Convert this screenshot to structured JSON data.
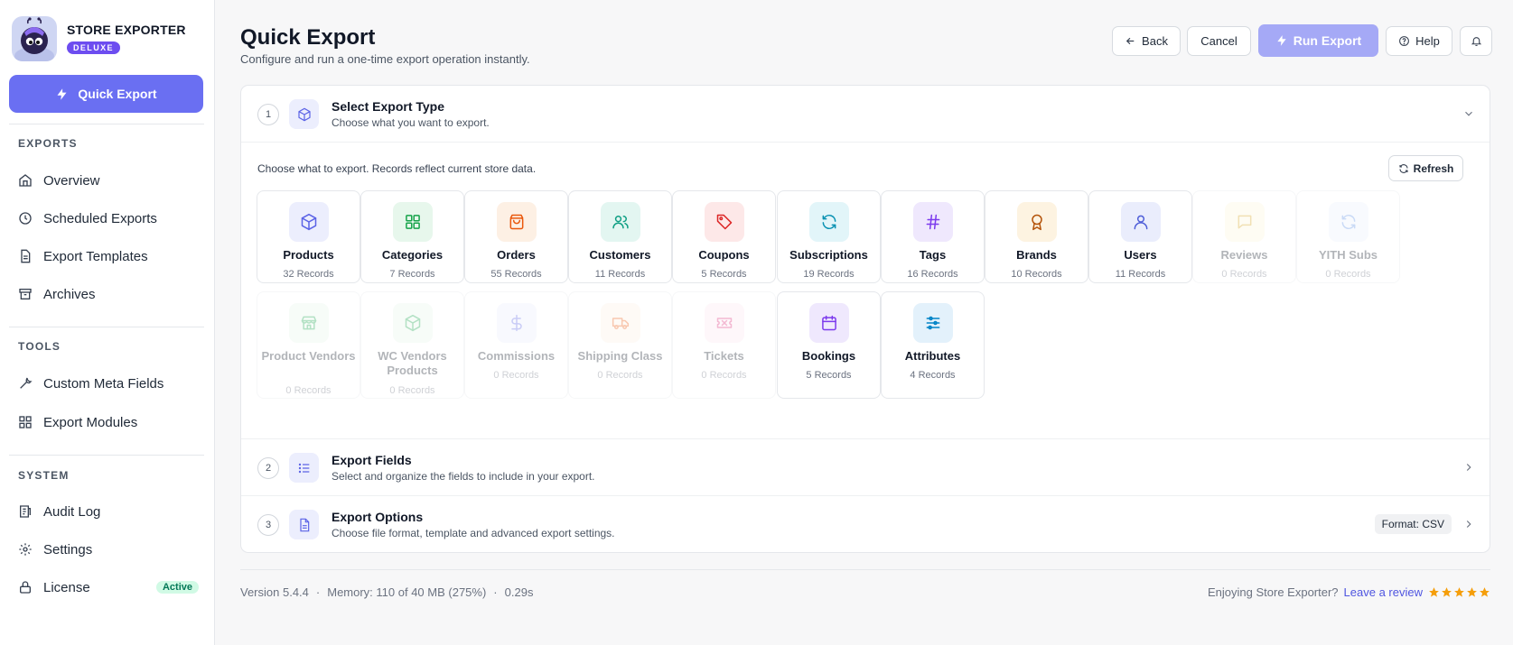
{
  "app": {
    "name": "STORE EXPORTER",
    "badge": "DELUXE"
  },
  "sidebar": {
    "quick_export_label": "Quick Export",
    "sections": [
      {
        "label": "EXPORTS",
        "items": [
          {
            "label": "Overview",
            "icon": "home-icon"
          },
          {
            "label": "Scheduled Exports",
            "icon": "clock-icon"
          },
          {
            "label": "Export Templates",
            "icon": "document-icon"
          },
          {
            "label": "Archives",
            "icon": "archive-icon"
          }
        ]
      },
      {
        "label": "TOOLS",
        "items": [
          {
            "label": "Custom Meta Fields",
            "icon": "wrench-icon"
          },
          {
            "label": "Export Modules",
            "icon": "grid-icon"
          }
        ]
      },
      {
        "label": "SYSTEM",
        "items": [
          {
            "label": "Audit Log",
            "icon": "log-icon"
          },
          {
            "label": "Settings",
            "icon": "gear-icon"
          },
          {
            "label": "License",
            "icon": "lock-icon",
            "badge": "Active"
          }
        ]
      }
    ]
  },
  "header": {
    "title": "Quick Export",
    "subtitle": "Configure and run a one-time export operation instantly.",
    "back_label": "Back",
    "cancel_label": "Cancel",
    "run_label": "Run Export",
    "help_label": "Help"
  },
  "steps": [
    {
      "num": "1",
      "title": "Select Export Type",
      "subtitle": "Choose what you want to export."
    },
    {
      "num": "2",
      "title": "Export Fields",
      "subtitle": "Select and organize the fields to include in your export."
    },
    {
      "num": "3",
      "title": "Export Options",
      "subtitle": "Choose file format, template and advanced export settings.",
      "badge": "Format: CSV"
    }
  ],
  "export_types": {
    "description": "Choose what to export. Records reflect current store data.",
    "refresh_label": "Refresh",
    "items": [
      {
        "name": "Products",
        "count": "32 Records",
        "icon": "box-icon",
        "color": "#5b63e6",
        "bg": "#eceefd",
        "enabled": true
      },
      {
        "name": "Categories",
        "count": "7 Records",
        "icon": "grid-icon",
        "color": "#16a34a",
        "bg": "#e7f7ec",
        "enabled": true
      },
      {
        "name": "Orders",
        "count": "55 Records",
        "icon": "bag-icon",
        "color": "#ea580c",
        "bg": "#fdf0e4",
        "enabled": true
      },
      {
        "name": "Customers",
        "count": "11 Records",
        "icon": "users-icon",
        "color": "#0f9f84",
        "bg": "#e3f6f1",
        "enabled": true
      },
      {
        "name": "Coupons",
        "count": "5 Records",
        "icon": "tag-icon",
        "color": "#dc2626",
        "bg": "#fde8e8",
        "enabled": true
      },
      {
        "name": "Subscriptions",
        "count": "19 Records",
        "icon": "refresh-icon",
        "color": "#0891b2",
        "bg": "#e2f5f9",
        "enabled": true
      },
      {
        "name": "Tags",
        "count": "16 Records",
        "icon": "hash-icon",
        "color": "#7c3aed",
        "bg": "#efe8fd",
        "enabled": true
      },
      {
        "name": "Brands",
        "count": "10 Records",
        "icon": "award-icon",
        "color": "#b45309",
        "bg": "#fdf3e1",
        "enabled": true
      },
      {
        "name": "Users",
        "count": "11 Records",
        "icon": "user-icon",
        "color": "#4f5ed8",
        "bg": "#eaedfc",
        "enabled": true
      },
      {
        "name": "Reviews",
        "count": "0 Records",
        "icon": "message-icon",
        "color": "#d4a017",
        "bg": "#fdf6dc",
        "enabled": false
      },
      {
        "name": "YITH Subs",
        "count": "0 Records",
        "icon": "refresh-icon",
        "color": "#5b8de6",
        "bg": "#eaf1fd",
        "enabled": false
      },
      {
        "name": "Product Vendors",
        "count": "0 Records",
        "icon": "store-icon",
        "color": "#16a34a",
        "bg": "#e7f7ec",
        "enabled": false
      },
      {
        "name": "WC Vendors Products",
        "count": "0 Records",
        "icon": "box-icon",
        "color": "#16a34a",
        "bg": "#e7f7ec",
        "enabled": false
      },
      {
        "name": "Commissions",
        "count": "0 Records",
        "icon": "dollar-icon",
        "color": "#5b63e6",
        "bg": "#eceefd",
        "enabled": false
      },
      {
        "name": "Shipping Class",
        "count": "0 Records",
        "icon": "truck-icon",
        "color": "#ea580c",
        "bg": "#fdf0e4",
        "enabled": false
      },
      {
        "name": "Tickets",
        "count": "0 Records",
        "icon": "ticket-icon",
        "color": "#db2777",
        "bg": "#fde8f1",
        "enabled": false
      },
      {
        "name": "Bookings",
        "count": "5 Records",
        "icon": "calendar-icon",
        "color": "#7c3aed",
        "bg": "#efe8fd",
        "enabled": true
      },
      {
        "name": "Attributes",
        "count": "4 Records",
        "icon": "sliders-icon",
        "color": "#0284c7",
        "bg": "#e3f1fb",
        "enabled": true
      }
    ]
  },
  "footer": {
    "version": "Version 5.4.4",
    "memory": "Memory: 110 of 40 MB (275%)",
    "time": "0.29s",
    "enjoy_text": "Enjoying Store Exporter?",
    "review_label": "Leave a review",
    "stars": 5
  }
}
